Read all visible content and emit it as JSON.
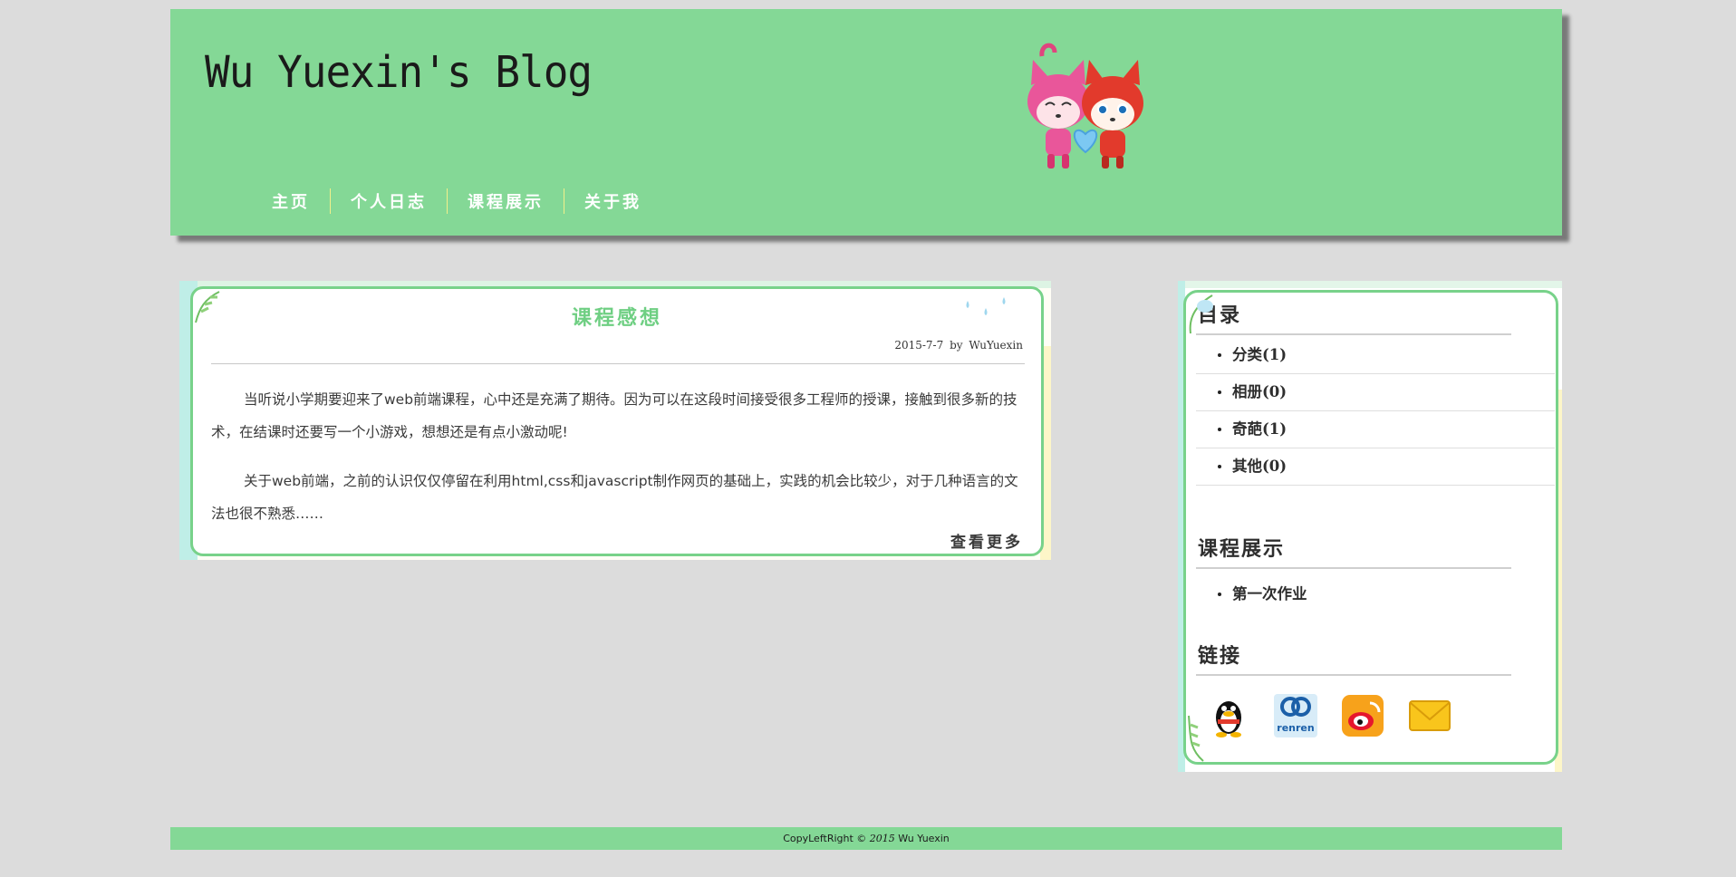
{
  "header": {
    "blog_title": "Wu Yuexin's Blog",
    "nav": [
      "主页",
      "个人日志",
      "课程展示",
      "关于我"
    ]
  },
  "article": {
    "title": "课程感想",
    "date": "2015-7-7",
    "by": "by",
    "author": "WuYuexin",
    "paragraphs": [
      "当听说小学期要迎来了web前端课程，心中还是充满了期待。因为可以在这段时间接受很多工程师的授课，接触到很多新的技术，在结课时还要写一个小游戏，想想还是有点小激动呢!",
      "关于web前端，之前的认识仅仅停留在利用html,css和javascript制作网页的基础上，实践的机会比较少，对于几种语言的文法也很不熟悉……"
    ],
    "read_more": "查看更多"
  },
  "sidebar": {
    "catalog_title": "目录",
    "catalog": [
      "分类(1)",
      "相册(0)",
      "奇葩(1)",
      "其他(0)"
    ],
    "courses_title": "课程展示",
    "courses": [
      "第一次作业"
    ],
    "links_title": "链接",
    "links": [
      "qq-icon",
      "renren-icon",
      "weibo-icon",
      "mail-icon"
    ],
    "renren_text": "renren"
  },
  "footer": {
    "prefix": "CopyLeftRight ©",
    "year": "2015",
    "name": "Wu Yuexin"
  },
  "colors": {
    "header_green": "#84d896",
    "title_green": "#6fcf83",
    "frame_green": "#78d28a",
    "page_bg": "#dcdcdc"
  }
}
